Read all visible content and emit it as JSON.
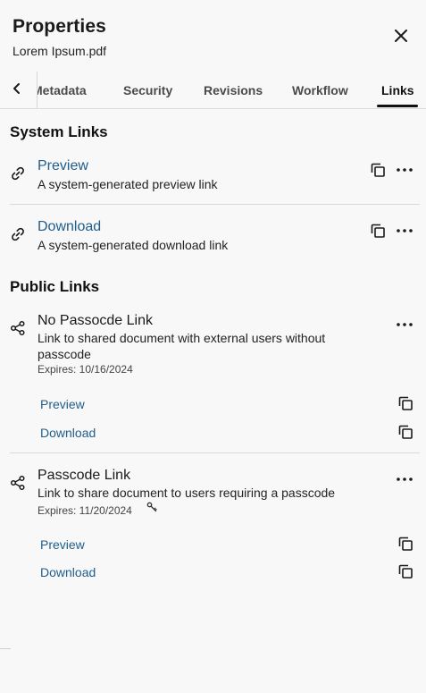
{
  "panel": {
    "title": "Properties",
    "file_name": "Lorem Ipsum.pdf"
  },
  "tabs": [
    {
      "label": "Metadata",
      "active": false
    },
    {
      "label": "Security",
      "active": false
    },
    {
      "label": "Revisions",
      "active": false
    },
    {
      "label": "Workflow",
      "active": false
    },
    {
      "label": "Links",
      "active": true
    }
  ],
  "system_links": {
    "heading": "System Links",
    "items": [
      {
        "title": "Preview",
        "description": "A system-generated preview link"
      },
      {
        "title": "Download",
        "description": "A system-generated download link"
      }
    ]
  },
  "public_links": {
    "heading": "Public Links",
    "items": [
      {
        "title": "No Passocde Link",
        "description": "Link to shared document with external users without passcode",
        "expires": "Expires: 10/16/2024",
        "preview_label": "Preview",
        "download_label": "Download"
      },
      {
        "title": "Passcode Link",
        "description": "Link to share document to users requiring a passcode",
        "expires": "Expires: 11/20/2024",
        "preview_label": "Preview",
        "download_label": "Download"
      }
    ]
  },
  "colors": {
    "link": "#1f5d8c",
    "background": "#f8f8f8",
    "active_tab_indicator": "#111111"
  }
}
